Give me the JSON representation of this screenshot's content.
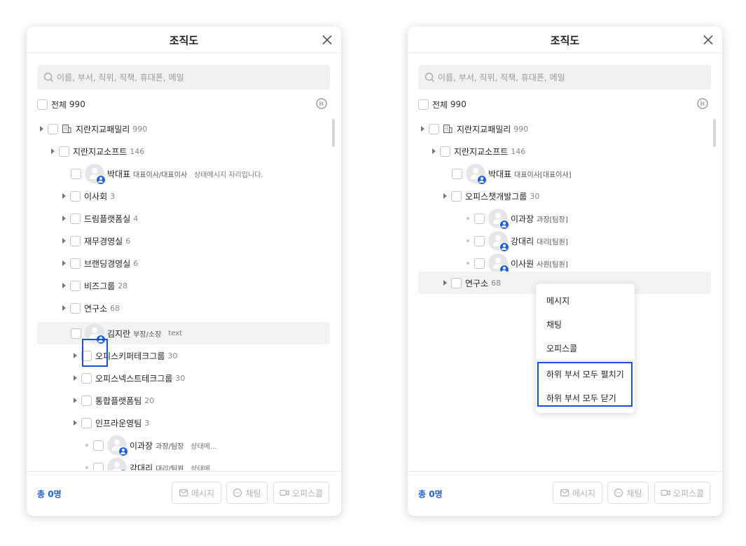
{
  "left": {
    "title": "조직도",
    "search_placeholder": "이름, 부서, 직위, 직책, 휴대폰, 메일",
    "all": {
      "label": "전체",
      "count": "990"
    },
    "tree": [
      {
        "name": "지란지교패밀리",
        "count": "990"
      },
      {
        "name": "지란지교소프트",
        "count": "146"
      },
      {
        "name": "박대표",
        "position": "대표이사/대표이사",
        "status": "상태메시지 자리입니다."
      },
      {
        "name": "이사회",
        "count": "3"
      },
      {
        "name": "드림플랫폼실",
        "count": "4"
      },
      {
        "name": "재무경영실",
        "count": "6"
      },
      {
        "name": "브랜딩경영실",
        "count": "6"
      },
      {
        "name": "비즈그룹",
        "count": "28"
      },
      {
        "name": "연구소",
        "count": "68"
      },
      {
        "name": "김지란",
        "position": "부장/소장",
        "status": "text"
      },
      {
        "name": "오피스키퍼테크그룹",
        "count": "30"
      },
      {
        "name": "오피스넥스트테크그룹",
        "count": "30"
      },
      {
        "name": "통합플랫폼팀",
        "count": "20"
      },
      {
        "name": "인프라운영팀",
        "count": "3"
      },
      {
        "name": "이과장",
        "position": "과장/팀장",
        "status": "상태메..."
      },
      {
        "name": "강대리",
        "position": "대리/팀원",
        "status": "상태메..."
      }
    ],
    "footer": {
      "total": "총 0명",
      "message": "메시지",
      "chat": "채팅",
      "officecall": "오피스콜"
    }
  },
  "right": {
    "title": "조직도",
    "search_placeholder": "이름, 부서, 직위, 직책, 휴대폰, 메일",
    "all": {
      "label": "전체",
      "count": "990"
    },
    "tree": [
      {
        "name": "지란지교패밀리",
        "count": "990"
      },
      {
        "name": "지란지교소프트",
        "count": "146"
      },
      {
        "name": "박대표",
        "position": "대표이사[대표이사]"
      },
      {
        "name": "오피스챗개발그룹",
        "count": "30"
      },
      {
        "name": "이과장",
        "position": "과장[팀장]"
      },
      {
        "name": "강대리",
        "position": "대리[팀원]"
      },
      {
        "name": "이사원",
        "position": "사원[팀원]"
      },
      {
        "name": "연구소",
        "count": "68"
      }
    ],
    "context_menu": [
      "메시지",
      "채팅",
      "오피스콜",
      "하위 부서 모두 펼치기",
      "하위 부서 모두 닫기"
    ],
    "footer": {
      "total": "총 0명",
      "message": "메시지",
      "chat": "채팅",
      "officecall": "오피스콜"
    }
  },
  "colors": {
    "accent": "#1f5fe0",
    "highlight_box": "#1a4fd8",
    "row_hover": "#f2f3f5"
  }
}
